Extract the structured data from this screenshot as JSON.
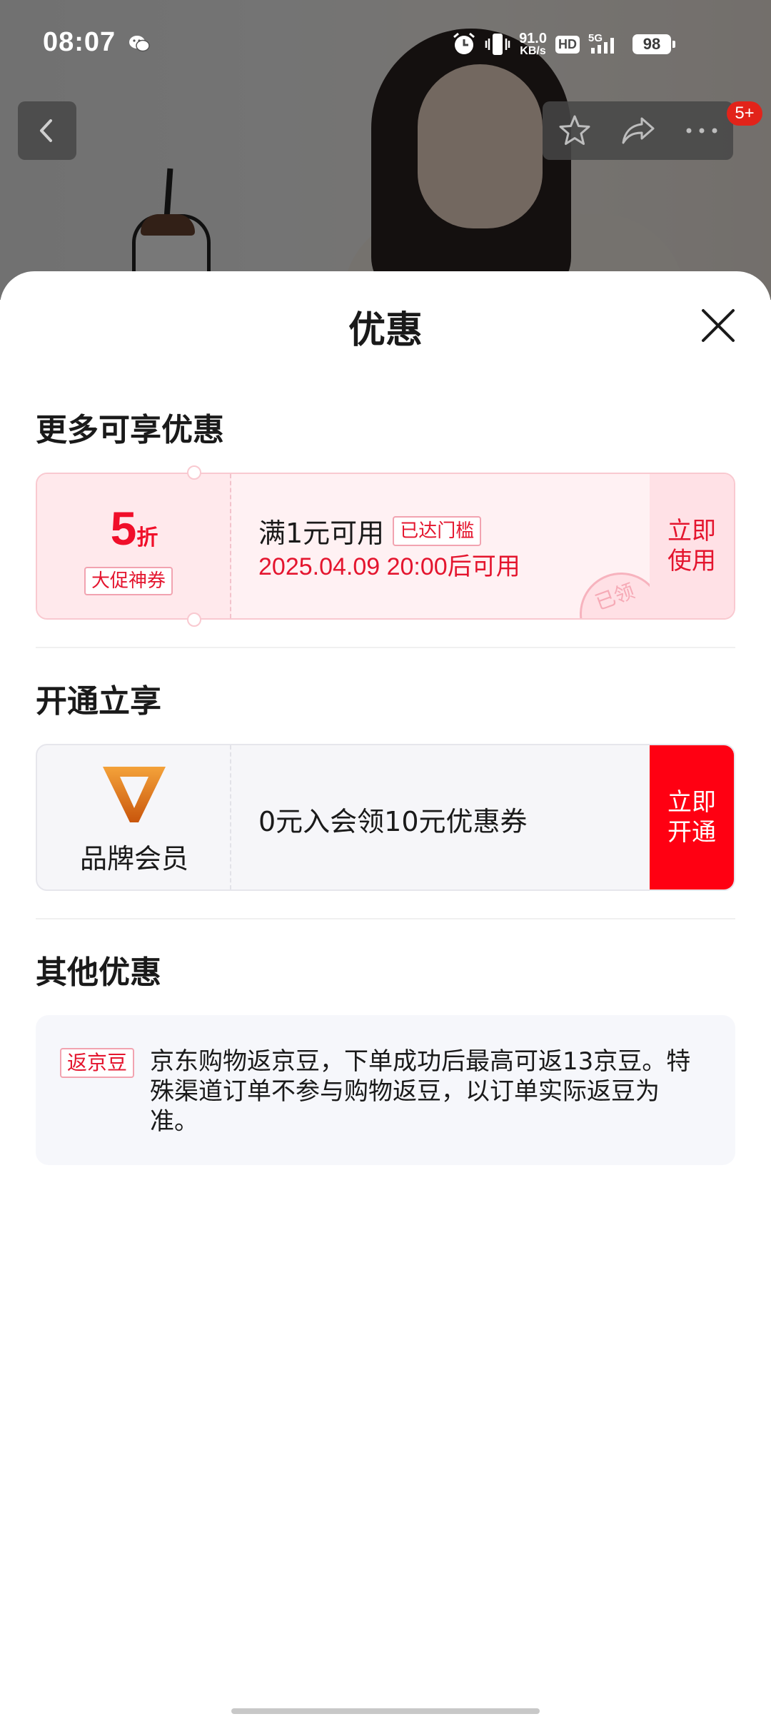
{
  "status_bar": {
    "time": "08:07",
    "net_speed_value": "91.0",
    "net_speed_unit": "KB/s",
    "hd": "HD",
    "network": "5G",
    "battery": "98"
  },
  "nav": {
    "cart_badge": "5+"
  },
  "sheet": {
    "title": "优惠",
    "more_section": {
      "title": "更多可享优惠",
      "coupon": {
        "discount_value": "5",
        "discount_unit": "折",
        "type_label": "大促神券",
        "condition": "满1元可用",
        "threshold_tag": "已达门槛",
        "valid_time": "2025.04.09 20:00后可用",
        "stamp_text": "已领",
        "action_line1": "立即",
        "action_line2": "使用"
      }
    },
    "open_section": {
      "title": "开通立享",
      "member": {
        "label": "品牌会员",
        "description": "0元入会领10元优惠券",
        "action_line1": "立即",
        "action_line2": "开通"
      }
    },
    "other_section": {
      "title": "其他优惠",
      "tag": "返京豆",
      "text": "京东购物返京豆，下单成功后最高可返13京豆。特殊渠道订单不参与购物返豆，以订单实际返豆为准。"
    }
  },
  "colors": {
    "accent_red": "#e4152e",
    "cta_red": "#ff0012",
    "coupon_bg": "#fff1f3",
    "member_logo_orange": "#e0700f"
  },
  "icons": {
    "wechat": "wechat-icon",
    "alarm": "alarm-icon",
    "vibrate": "vibrate-icon",
    "back": "chevron-left-icon",
    "favorite": "star-icon",
    "share": "share-icon",
    "more": "more-icon",
    "close": "close-icon",
    "member_logo": "brand-v-logo-icon"
  }
}
